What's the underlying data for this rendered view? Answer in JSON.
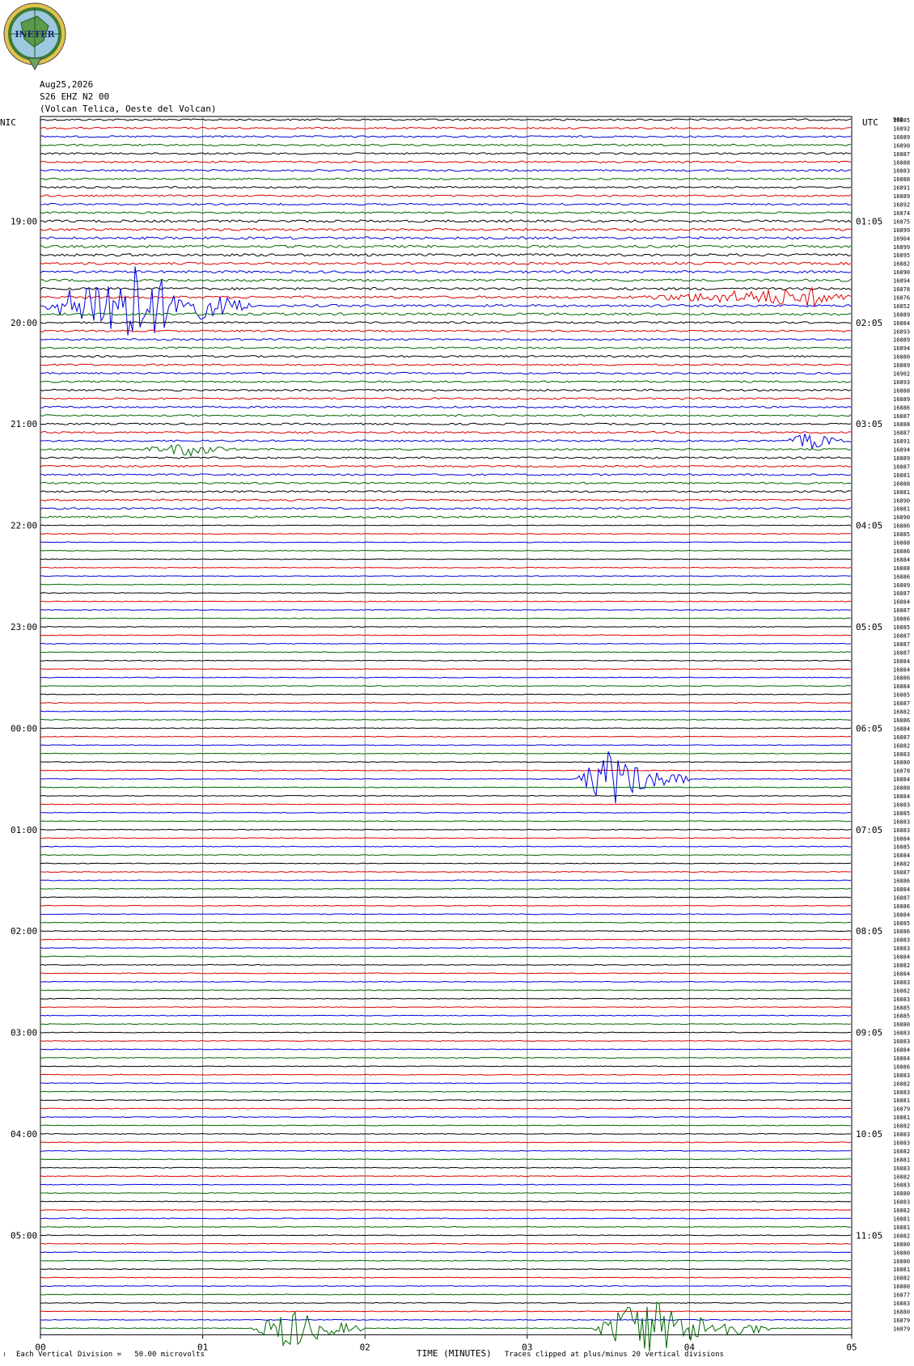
{
  "logo": {
    "text": "INETER",
    "colors": {
      "ring": "#3f7a3a",
      "sea": "#9cc9df",
      "gold": "#e3c24a"
    }
  },
  "header": {
    "date": "Aug25,2026",
    "channel": "S26 EHZ N2 00",
    "station": "(Volcan Telica, Oeste del Volcan)"
  },
  "left_zone": "NIC",
  "right_zone": "UTC",
  "footer": {
    "scale_note": "Each Vertical Division =   50.00 microvolts",
    "clip_note": "Traces clipped at plus/minus 20 vertical divisions",
    "corner_mark": "≀"
  },
  "chart_data": {
    "type": "line",
    "title": "",
    "xlabel": "TIME (MINUTES)",
    "ylabel": "",
    "xlim": [
      0,
      5
    ],
    "x_ticks": [
      "00",
      "01",
      "02",
      "03",
      "04",
      "05"
    ],
    "trace_count": 144,
    "trace_interval_minutes": 5,
    "trace_color_cycle": [
      "#000000",
      "#dd0000",
      "#0000dd",
      "#006600"
    ],
    "left_hour_labels": [
      "19:00",
      "20:00",
      "21:00",
      "22:00",
      "23:00",
      "00:00",
      "01:00",
      "02:00",
      "03:00",
      "04:00",
      "05:00"
    ],
    "right_hour_labels": [
      "01:05",
      "02:05",
      "03:05",
      "04:05",
      "05:05",
      "06:05",
      "07:05",
      "08:05",
      "09:05",
      "10:05",
      "11:05"
    ],
    "first_hour_row": 12,
    "rows_per_hour": 12,
    "right_top_label": "966",
    "row_values": [
      "16885",
      "16892",
      "16889",
      "16890",
      "16887",
      "16888",
      "16883",
      "16888",
      "16891",
      "16889",
      "16892",
      "16874",
      "16875",
      "16899",
      "16904",
      "16899",
      "16895",
      "16882",
      "16890",
      "16894",
      "16878",
      "16876",
      "16852",
      "16889",
      "16884",
      "16893",
      "16889",
      "16894",
      "16880",
      "16889",
      "16902",
      "16893",
      "16888",
      "16889",
      "16886",
      "16887",
      "16888",
      "16887",
      "16891",
      "16894",
      "16889",
      "16887",
      "16881",
      "16888",
      "16881",
      "16890",
      "16881",
      "16890",
      "16886",
      "16885",
      "16888",
      "16886",
      "16884",
      "16888",
      "16886",
      "16889",
      "16887",
      "16884",
      "16887",
      "16886",
      "16885",
      "16887",
      "16887",
      "16887",
      "16884",
      "16884",
      "16886",
      "16884",
      "16885",
      "16887",
      "16882",
      "16886",
      "16884",
      "16887",
      "16882",
      "16883",
      "16880",
      "16878",
      "16884",
      "16888",
      "16884",
      "16883",
      "16885",
      "16883",
      "16883",
      "16884",
      "16885",
      "16884",
      "16882",
      "16887",
      "16886",
      "16884",
      "16887",
      "16886",
      "16884",
      "16885",
      "16886",
      "16883",
      "16883",
      "16884",
      "16882",
      "16884",
      "16883",
      "16882",
      "16883",
      "16885",
      "16885",
      "16880",
      "16883",
      "16883",
      "16884",
      "16884",
      "16886",
      "16883",
      "16882",
      "16883",
      "16881",
      "16879",
      "16881",
      "16882",
      "16883",
      "16883",
      "16882",
      "16881",
      "16883",
      "16882",
      "16883",
      "16880",
      "16883",
      "16882",
      "16881",
      "16881",
      "16882",
      "16880",
      "16880",
      "16880",
      "16881",
      "16882",
      "16880",
      "16877",
      "16883",
      "16880",
      "16879",
      "16879"
    ],
    "events": [
      {
        "row": 22,
        "minute_start": 0.0,
        "minute_end": 1.3,
        "peak_minute": 0.55,
        "amplitude_div": 6
      },
      {
        "row": 21,
        "minute_start": 3.6,
        "minute_end": 5.0,
        "peak_minute": 4.8,
        "amplitude_div": 1.2
      },
      {
        "row": 38,
        "minute_start": 4.6,
        "minute_end": 5.0,
        "peak_minute": 4.75,
        "amplitude_div": 1.2
      },
      {
        "row": 39,
        "minute_start": 0.6,
        "minute_end": 1.2,
        "peak_minute": 0.95,
        "amplitude_div": 0.9
      },
      {
        "row": 78,
        "minute_start": 3.3,
        "minute_end": 4.0,
        "peak_minute": 3.5,
        "amplitude_div": 4
      },
      {
        "row": 143,
        "minute_start": 1.3,
        "minute_end": 2.0,
        "peak_minute": 1.55,
        "amplitude_div": 3
      },
      {
        "row": 143,
        "minute_start": 3.4,
        "minute_end": 4.5,
        "peak_minute": 3.7,
        "amplitude_div": 4.5
      }
    ]
  }
}
